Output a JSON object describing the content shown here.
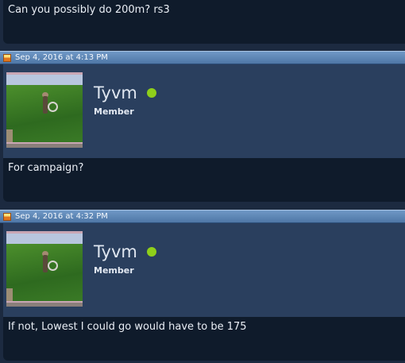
{
  "posts": [
    {
      "body": "Can you possibly do 200m? rs3"
    },
    {
      "date": "Sep 4, 2016 at 4:13 PM",
      "author": {
        "name": "Tyvm",
        "role": "Member"
      },
      "body": "For campaign?"
    },
    {
      "date": "Sep 4, 2016 at 4:32 PM",
      "author": {
        "name": "Tyvm",
        "role": "Member"
      },
      "body": "If not, Lowest I could go would have to be 175"
    }
  ],
  "icons": {
    "date": "calendar-icon",
    "status": "online-status-icon"
  },
  "colors": {
    "online": "#8fcf1a",
    "date_bar": "#5b84b3",
    "message_bg": "#0f1b2b",
    "author_bg": "#2a3f5e"
  }
}
